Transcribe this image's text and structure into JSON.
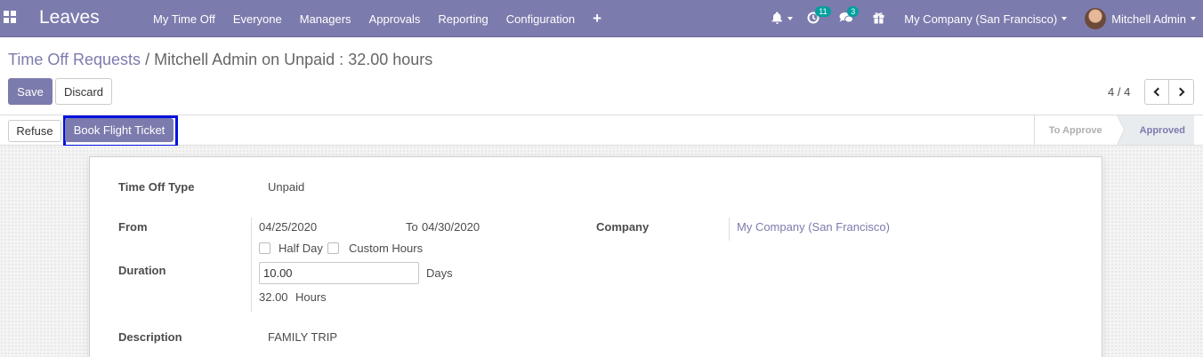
{
  "navbar": {
    "brand": "Leaves",
    "menu": [
      "My Time Off",
      "Everyone",
      "Managers",
      "Approvals",
      "Reporting",
      "Configuration"
    ],
    "activity_count": "11",
    "messages_count": "3",
    "company": "My Company (San Francisco)",
    "user": "Mitchell Admin"
  },
  "breadcrumb": {
    "parent": "Time Off Requests",
    "separator": "/",
    "current": "Mitchell Admin on Unpaid : 32.00 hours"
  },
  "buttons": {
    "save": "Save",
    "discard": "Discard",
    "refuse": "Refuse",
    "book_flight": "Book Flight Ticket"
  },
  "pager": {
    "value": "4 / 4"
  },
  "stages": {
    "to_approve": "To Approve",
    "approved": "Approved"
  },
  "form": {
    "time_off_type_label": "Time Off Type",
    "time_off_type_value": "Unpaid",
    "from_label": "From",
    "date_from": "04/25/2020",
    "to_label": "To",
    "date_to": "04/30/2020",
    "half_day_label": "Half Day",
    "custom_hours_label": "Custom Hours",
    "duration_label": "Duration",
    "duration_days": "10.00",
    "days_unit": "Days",
    "duration_hours": "32.00",
    "hours_unit": "Hours",
    "company_label": "Company",
    "company_value": "My Company (San Francisco)",
    "description_label": "Description",
    "description_value": "FAMILY TRIP"
  },
  "colors": {
    "brand": "#7c7bad",
    "highlight": "#0010e0",
    "badge": "#00a09d"
  }
}
